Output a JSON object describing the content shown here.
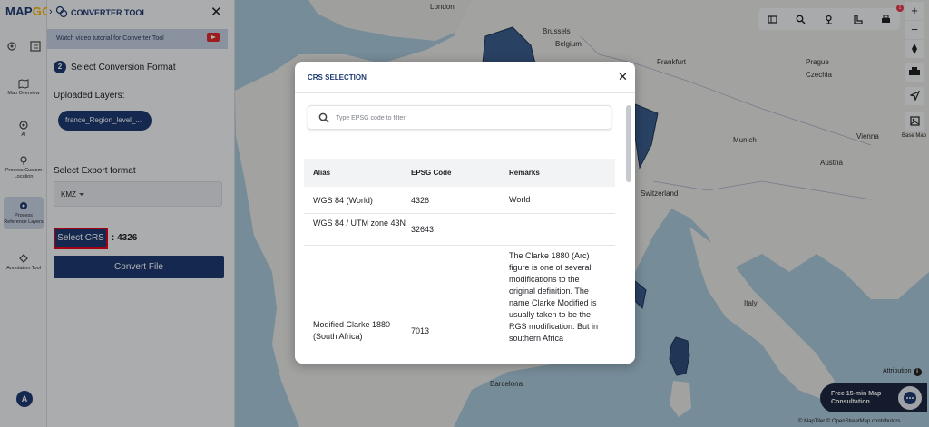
{
  "app": {
    "logo_text": "MAP",
    "logo_suffix": "GO"
  },
  "rail": {
    "items": [
      {
        "label": "Map Overview"
      },
      {
        "label": "AI"
      },
      {
        "label": "Process Custom Location"
      },
      {
        "label": "Process Reference Layers"
      },
      {
        "label": "Annotation Tool"
      }
    ],
    "avatar_initial": "A"
  },
  "panel": {
    "title": "CONVERTER TOOL",
    "tutorial_text": "Watch video tutorial for Converter Tool",
    "step_number": "2",
    "step_label": "Select Conversion Format",
    "uploaded_layers_label": "Uploaded Layers:",
    "layer_name": "france_Region_level_...",
    "export_format_label": "Select Export format",
    "export_format_value": "KMZ",
    "select_crs_label": "Select CRS",
    "crs_value": ": 4326",
    "convert_label": "Convert File"
  },
  "map": {
    "labels": {
      "london": "London",
      "brussels": "Brussels",
      "belgium": "Belgium",
      "frankfurt": "Frankfurt",
      "prague": "Prague",
      "czechia": "Czechia",
      "switzerland": "Switzerland",
      "munich": "Munich",
      "vienna": "Vienna",
      "austria": "Austria",
      "barcelona": "Barcelona",
      "italy": "Italy"
    },
    "toolbar_badge": "1",
    "basemap_label": "Base Map",
    "attribution_label": "Attribution",
    "consult_text": "Free 15-min Map Consultation",
    "copyright": "© MapTiler © OpenStreetMap contributors"
  },
  "modal": {
    "title": "CRS SELECTION",
    "search_placeholder": "Type EPSG code to filter",
    "columns": [
      "Alias",
      "EPSG Code",
      "Remarks"
    ],
    "rows": [
      {
        "alias": "WGS 84 (World)",
        "code": "4326",
        "remarks": "World"
      },
      {
        "alias": "WGS 84 / UTM zone 43N",
        "code": "32643",
        "remarks": ""
      },
      {
        "alias": "Modified Clarke 1880 (South Africa)",
        "code": "7013",
        "remarks": "The Clarke 1880 (Arc) figure is one of several modifications to the original definition. The name Clarke Modified is usually taken to be the RGS modification. But in southern Africa"
      }
    ]
  }
}
